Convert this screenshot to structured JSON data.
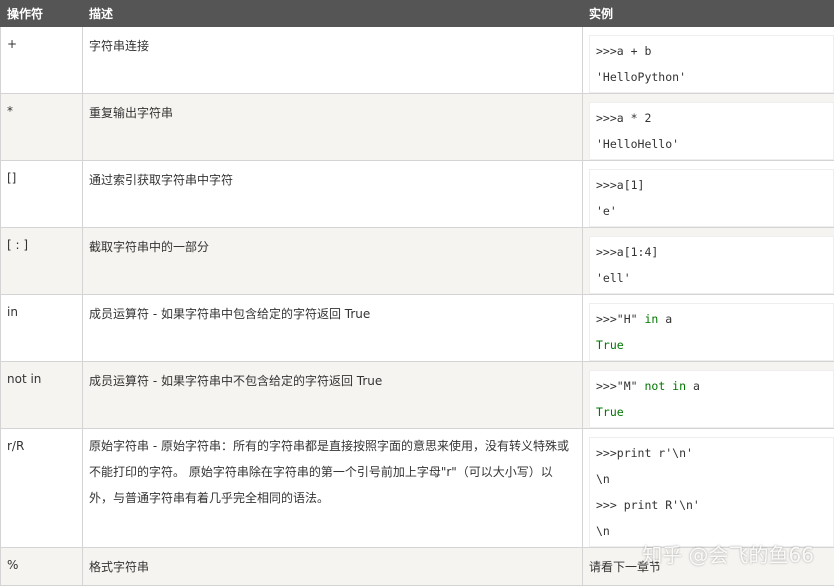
{
  "headers": [
    "操作符",
    "描述",
    "实例"
  ],
  "rows": [
    {
      "op": "+",
      "desc": "字符串连接",
      "ex1": ">>>a + b",
      "ex2": "'HelloPython'"
    },
    {
      "op": "*",
      "desc": "重复输出字符串",
      "ex1": ">>>a * 2",
      "ex2": "'HelloHello'"
    },
    {
      "op": "[]",
      "desc": "通过索引获取字符串中字符",
      "ex1": ">>>a[1]",
      "ex2": "'e'"
    },
    {
      "op": "[ : ]",
      "desc": "截取字符串中的一部分",
      "ex1": ">>>a[1:4]",
      "ex2": "'ell'"
    },
    {
      "op": "in",
      "desc": "成员运算符 - 如果字符串中包含给定的字符返回 True",
      "ex1_pre": ">>>\"H\" ",
      "ex1_kw": "in",
      "ex1_post": " a",
      "ex2": "True"
    },
    {
      "op": "not in",
      "desc": "成员运算符 - 如果字符串中不包含给定的字符返回 True",
      "ex1_pre": ">>>\"M\" ",
      "ex1_kw": "not in",
      "ex1_post": " a",
      "ex2": "True"
    },
    {
      "op": "r/R",
      "desc": "原始字符串 - 原始字符串：所有的字符串都是直接按照字面的意思来使用，没有转义特殊或不能打印的字符。 原始字符串除在字符串的第一个引号前加上字母\"r\"（可以大小写）以外，与普通字符串有着几乎完全相同的语法。",
      "ex1": ">>>print r'\\n'",
      "ex2": "\\n",
      "ex3": ">>> print R'\\n'",
      "ex4": "\\n"
    },
    {
      "op": "%",
      "desc": "格式字符串",
      "ex_plain": "请看下一章节"
    }
  ],
  "watermark": "知乎 @会飞的鱼66"
}
